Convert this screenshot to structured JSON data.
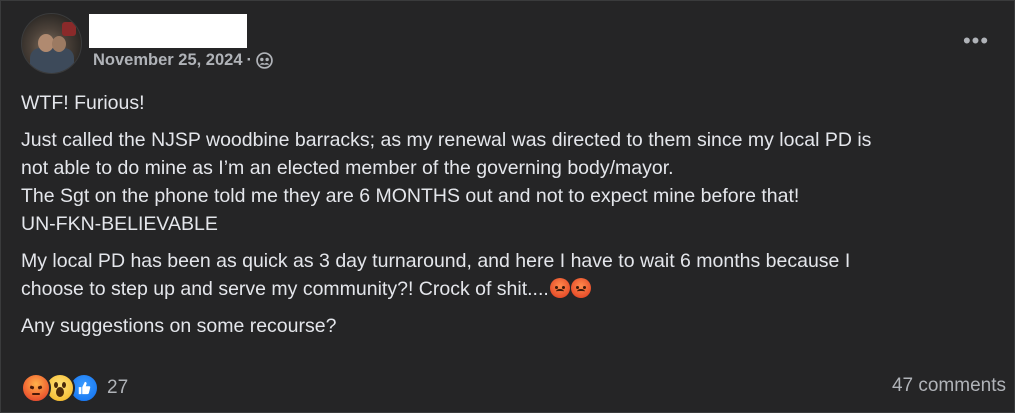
{
  "post": {
    "date": "November 25, 2024",
    "separator": "·",
    "audience_icon": "group-icon",
    "more_icon": "ellipsis-icon",
    "more_label": "•••",
    "paragraphs": {
      "p1": "WTF! Furious!",
      "p2_line1": "Just called the NJSP woodbine barracks; as my renewal was directed to them since my local PD is",
      "p2_line2": "not able to do mine as I’m an elected member of the governing body/mayor.",
      "p2_line3": "The Sgt on the phone told me they are 6 MONTHS out and not to expect mine before that!",
      "p2_line4": "UN-FKN-BELIEVABLE",
      "p3_line1": "My local PD has been as quick as 3 day turnaround, and here I have to wait 6 months because I",
      "p3_line2": "choose to step up and serve my community?! Crock of shit....",
      "p4": "Any suggestions on some recourse?"
    },
    "inline_emojis": [
      "angry-face-emoji",
      "angry-face-emoji"
    ],
    "reactions": {
      "icons": [
        "angry-reaction",
        "wow-reaction",
        "like-reaction"
      ],
      "count": "27"
    },
    "comments_label": "47 comments"
  },
  "colors": {
    "background": "#252526",
    "text": "#e4e6eb",
    "secondary_text": "#b0b3b8",
    "redaction": "#ffffff"
  }
}
